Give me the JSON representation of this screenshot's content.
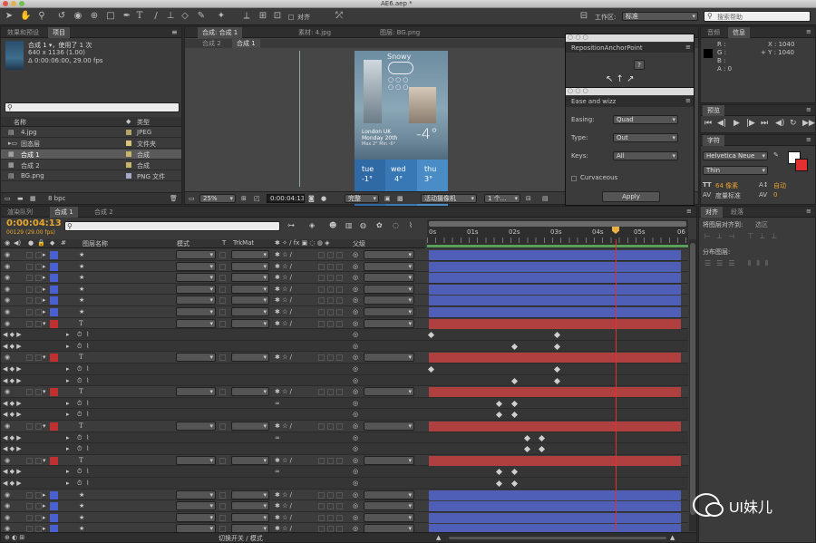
{
  "window": {
    "title": "AE6.aep *"
  },
  "toolbar": {
    "snap_label": "对齐",
    "workspace_label": "工作区:",
    "workspace_value": "标准",
    "search_placeholder": "搜索帮助"
  },
  "project_panel": {
    "tabs": [
      "效果和预设",
      "项目"
    ],
    "comp_name": "合成 1 ▾，使用了 1 次",
    "comp_size": "640 x 1136 (1.00)",
    "comp_duration": "Δ 0:00:06:00, 29.00 fps",
    "col_name": "名称",
    "col_type": "类型",
    "items": [
      {
        "name": "4.jpg",
        "type": "JPEG",
        "color": "#b5a46a"
      },
      {
        "name": "固态层",
        "type": "文件夹",
        "color": "#d9c47a"
      },
      {
        "name": "合成 1",
        "type": "合成",
        "color": "#c9b56a"
      },
      {
        "name": "合成 2",
        "type": "合成",
        "color": "#c9b56a"
      },
      {
        "name": "BG.png",
        "type": "PNG 文件",
        "color": "#a8a8c8"
      }
    ],
    "bpc": "8 bpc"
  },
  "viewer": {
    "tabs": [
      "合成: 合成 1",
      "素材: 4.jpg",
      "图层: BG.png"
    ],
    "subtabs": [
      "合成 2",
      "合成 1"
    ],
    "zoom": "25%",
    "timecode": "0:00:04:13",
    "quality": "完整",
    "camera": "活动摄像机",
    "view": "1 个..."
  },
  "phone": {
    "weather": "Snowy",
    "location": "London UK",
    "date": "Monday 20th",
    "range": "Max 2° Min -6°",
    "temp": "-4°",
    "days": [
      {
        "day": "tue",
        "temp": "-1°"
      },
      {
        "day": "wed",
        "temp": "4°"
      },
      {
        "day": "thu",
        "temp": "3°"
      }
    ]
  },
  "floating_panels": {
    "reposition_title": "RepositionAnchorPoint",
    "reposition_button": "?",
    "ease_title": "Ease and wizz",
    "easing_label": "Easing:",
    "easing_value": "Quad",
    "type_label": "Type:",
    "type_value": "Out",
    "keys_label": "Keys:",
    "keys_value": "All",
    "curvaceous_label": "Curvaceous",
    "apply_label": "Apply"
  },
  "info_panel": {
    "tabs": [
      "音频",
      "信息"
    ],
    "r": "R :",
    "g": "G :",
    "b": "B :",
    "a": "A : 0",
    "x": "X : 1040",
    "y": "+ Y : 1040"
  },
  "preview_panel": {
    "tab": "预览"
  },
  "character_panel": {
    "tab": "字符",
    "font": "Helvetica Neue",
    "style": "Thin",
    "size": "64 像素",
    "leading": "自动",
    "kerning": "度量标准",
    "tracking": "0"
  },
  "align_panel": {
    "tabs": [
      "对齐",
      "段落"
    ],
    "align_to": "将图层对齐到:",
    "align_to_value": "选区",
    "distribute": "分布图层:"
  },
  "timeline": {
    "tabs": [
      "渲染队列",
      "合成 1",
      "合成 2"
    ],
    "timecode": "0:00:04:13",
    "frame_info": "00129 (29.00 fps)",
    "col_name": "图层名称",
    "col_mode": "模式",
    "col_t": "T",
    "col_trkmat": "TrkMat",
    "col_parent": "父级",
    "ruler": [
      "0s",
      "01s",
      "02s",
      "03s",
      "04s",
      "05s",
      "06"
    ],
    "layers": [
      {
        "num": "4",
        "name": "Circle 5",
        "kind": "layer",
        "color": "#4a5fd0",
        "mode": "正常",
        "trk": "无",
        "parent": "无",
        "bar": "#4f5fb8"
      },
      {
        "num": "5",
        "name": "Circle 4",
        "kind": "layer",
        "color": "#4a5fd0",
        "mode": "正常",
        "trk": "无",
        "parent": "无",
        "bar": "#4f5fb8"
      },
      {
        "num": "6",
        "name": "Circle 3",
        "kind": "layer",
        "color": "#4a5fd0",
        "mode": "正常",
        "trk": "无",
        "parent": "无",
        "bar": "#4f5fb8"
      },
      {
        "num": "7",
        "name": "Circle 2",
        "kind": "layer",
        "color": "#4a5fd0",
        "mode": "正常",
        "trk": "无",
        "parent": "无",
        "bar": "#4f5fb8"
      },
      {
        "num": "8",
        "name": "Circle 1",
        "kind": "layer",
        "color": "#4a5fd0",
        "mode": "正常",
        "trk": "无",
        "parent": "无",
        "bar": "#4f5fb8"
      },
      {
        "num": "9",
        "name": "Cloud",
        "kind": "layer",
        "color": "#4a5fd0",
        "mode": "正常",
        "trk": "无",
        "parent": "无",
        "bar": "#4f5fb8"
      },
      {
        "num": "10",
        "name": "-4°",
        "kind": "text",
        "color": "#c03030",
        "mode": "正常",
        "trk": "无",
        "parent": "无",
        "bar": "#b04040"
      },
      {
        "num": "",
        "name": "位置",
        "kind": "prop",
        "value": "524.8,684.3",
        "parent": "",
        "keys": [
          0.0,
          0.5
        ]
      },
      {
        "num": "",
        "name": "不透明度",
        "kind": "prop",
        "value": "100%",
        "parent": "",
        "keys": [
          0.33,
          0.5
        ]
      },
      {
        "num": "11",
        "name": "London ...ax 2° Min -6°",
        "kind": "text",
        "color": "#c03030",
        "mode": "正常",
        "trk": "无",
        "parent": "无",
        "bar": "#b04040"
      },
      {
        "num": "",
        "name": "位置",
        "kind": "prop",
        "value": "271.1,716.0",
        "parent": "",
        "keys": [
          0.0,
          0.5
        ]
      },
      {
        "num": "",
        "name": "不透明度",
        "kind": "prop",
        "value": "100%",
        "parent": "",
        "keys": [
          0.33,
          0.5
        ]
      },
      {
        "num": "12",
        "name": "thu 3°",
        "kind": "text",
        "color": "#c03030",
        "mode": "正常",
        "trk": "无",
        "parent": "无",
        "bar": "#b04040"
      },
      {
        "num": "",
        "name": "缩放",
        "kind": "prop",
        "value": "100.0,100.0%",
        "link": true,
        "parent": "",
        "keys": [
          0.27,
          0.33
        ]
      },
      {
        "num": "",
        "name": "不透明度",
        "kind": "prop",
        "value": "100%",
        "parent": "",
        "keys": [
          0.27,
          0.33
        ]
      },
      {
        "num": "13",
        "name": "wed 4°",
        "kind": "text",
        "color": "#c03030",
        "mode": "正常",
        "trk": "无",
        "parent": "无",
        "bar": "#b04040"
      },
      {
        "num": "",
        "name": "缩放",
        "kind": "prop",
        "value": "100.0,100.0%",
        "link": true,
        "parent": "",
        "keys": [
          0.38,
          0.44
        ]
      },
      {
        "num": "",
        "name": "不透明度",
        "kind": "prop",
        "value": "100%",
        "parent": "",
        "keys": [
          0.38,
          0.44
        ]
      },
      {
        "num": "14",
        "name": "tue -1°",
        "kind": "text",
        "color": "#c03030",
        "mode": "正常",
        "trk": "无",
        "parent": "无",
        "bar": "#b04040"
      },
      {
        "num": "",
        "name": "缩放",
        "kind": "prop",
        "value": "100.0,100.0%",
        "link": true,
        "parent": "",
        "keys": [
          0.27,
          0.33
        ]
      },
      {
        "num": "",
        "name": "不透明度",
        "kind": "prop",
        "value": "100%",
        "parent": "",
        "keys": [
          0.27,
          0.33
        ]
      },
      {
        "num": "15",
        "name": "形状图层 5",
        "kind": "shape",
        "color": "#4a5fd0",
        "mode": "正常",
        "trk": "无",
        "parent": "无",
        "bar": "#4f5fb8"
      },
      {
        "num": "16",
        "name": "形状图层 4",
        "kind": "shape",
        "color": "#4a5fd0",
        "mode": "正常",
        "trk": "无",
        "parent": "无",
        "bar": "#4f5fb8"
      },
      {
        "num": "17",
        "name": "形状图层 3",
        "kind": "shape",
        "color": "#4a5fd0",
        "mode": "正常",
        "trk": "无",
        "parent": "无",
        "bar": "#4f5fb8"
      },
      {
        "num": "18",
        "name": "形状图层 2",
        "kind": "shape",
        "color": "#4a5fd0",
        "mode": "正常",
        "trk": "无",
        "parent": "无",
        "bar": "#4f5fb8"
      }
    ],
    "bottom_label": "切换开关 / 模式"
  },
  "watermark": {
    "text": "UI妹儿"
  }
}
